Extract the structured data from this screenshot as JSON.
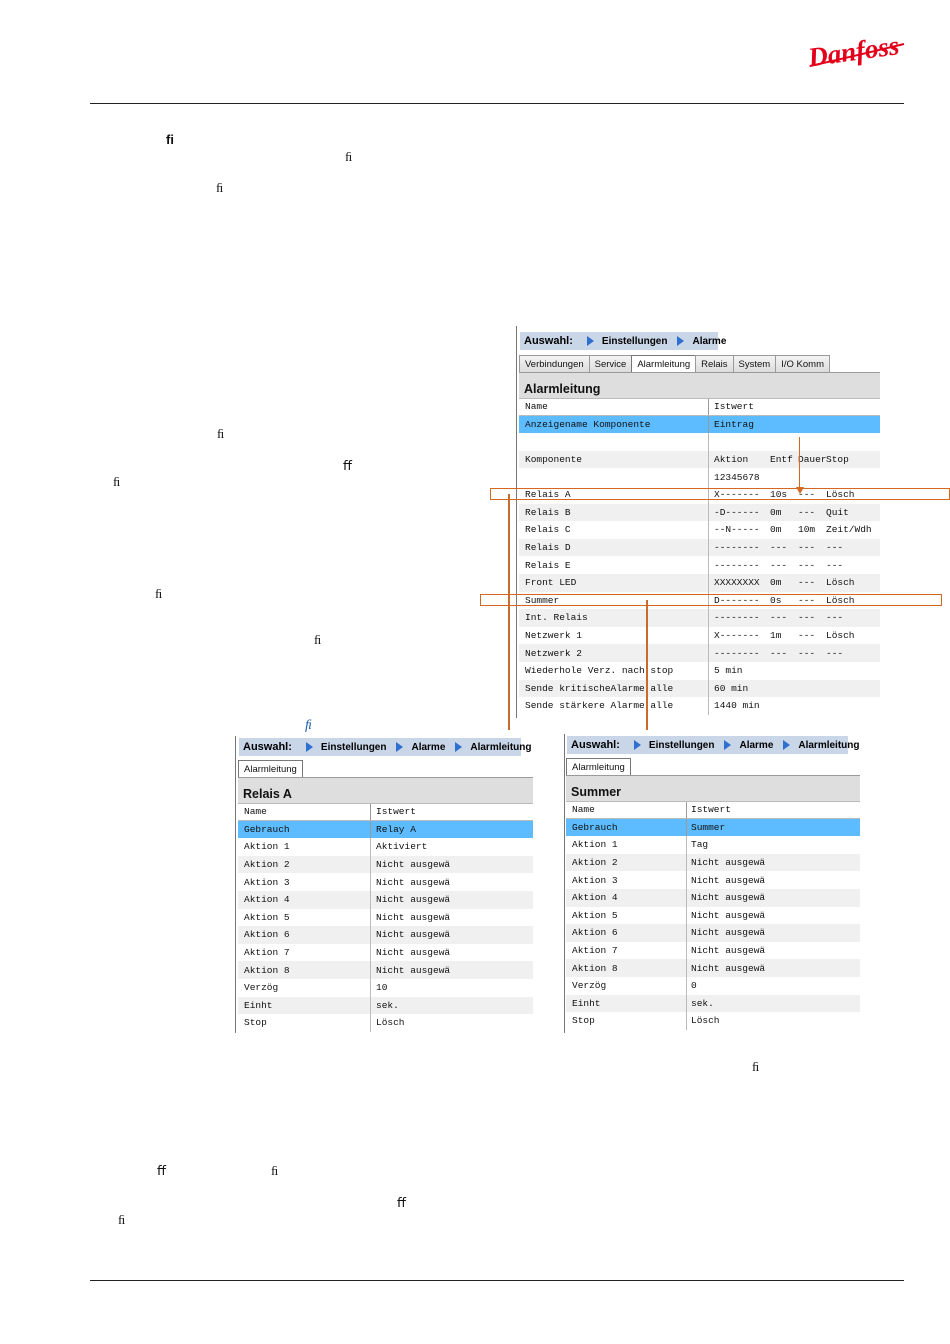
{
  "brand": {
    "logo_text": "Danfoss",
    "logo_color": "#e2001a"
  },
  "ligatures": [
    "ﬁ",
    "ﬁ",
    "ﬁ",
    "ﬁ",
    "ﬀ",
    "ﬁ",
    "ﬁ",
    "ﬁ",
    "ﬁ",
    "ﬁ",
    "ﬀ",
    "ﬁ",
    "ﬀ",
    "ﬁ"
  ],
  "alarm_panel": {
    "breadcrumb": {
      "label": "Auswahl:",
      "items": [
        "Einstellungen",
        "Alarme"
      ]
    },
    "tabs": [
      "Verbindungen",
      "Service",
      "Alarmleitung",
      "Relais",
      "System",
      "I/O Komm"
    ],
    "active_tab": 2,
    "title": "Alarmleitung",
    "header": {
      "name": "Name",
      "value": "Istwert"
    },
    "selected_row": {
      "name": "Anzeigename Komponente",
      "value": "Eintrag"
    },
    "komponente": {
      "name": "Komponente",
      "cols": [
        "Aktion",
        "Entf",
        "Dauer",
        "Stop"
      ],
      "serial": "12345678"
    },
    "rows": [
      {
        "name": "Relais A",
        "aktion": "X-------",
        "entf": "10s",
        "dauer": "---",
        "stop": "Lösch"
      },
      {
        "name": "Relais B",
        "aktion": "-D------",
        "entf": "0m",
        "dauer": "---",
        "stop": "Quit"
      },
      {
        "name": "Relais C",
        "aktion": "--N-----",
        "entf": "0m",
        "dauer": "10m",
        "stop": "Zeit/Wdh"
      },
      {
        "name": "Relais D",
        "aktion": "--------",
        "entf": "---",
        "dauer": "---",
        "stop": "---"
      },
      {
        "name": "Relais E",
        "aktion": "--------",
        "entf": "---",
        "dauer": "---",
        "stop": "---"
      },
      {
        "name": "Front LED",
        "aktion": "XXXXXXXX",
        "entf": "0m",
        "dauer": "---",
        "stop": "Lösch"
      },
      {
        "name": "Summer",
        "aktion": "D-------",
        "entf": "0s",
        "dauer": "---",
        "stop": "Lösch"
      },
      {
        "name": "Int. Relais",
        "aktion": "--------",
        "entf": "---",
        "dauer": "---",
        "stop": "---"
      },
      {
        "name": "Netzwerk 1",
        "aktion": "X-------",
        "entf": "1m",
        "dauer": "---",
        "stop": "Lösch"
      },
      {
        "name": "Netzwerk 2",
        "aktion": "--------",
        "entf": "---",
        "dauer": "---",
        "stop": "---"
      }
    ],
    "footer_rows": [
      {
        "name": "Wiederhole Verz. nach stop",
        "value": "5 min"
      },
      {
        "name": "Sende kritischeAlarme  alle",
        "value": "60 min"
      },
      {
        "name": "Sende stärkere Alarme alle",
        "value": "1440 min"
      }
    ]
  },
  "relais_panel": {
    "breadcrumb": {
      "label": "Auswahl:",
      "items": [
        "Einstellungen",
        "Alarme",
        "Alarmleitung"
      ]
    },
    "tab": "Alarmleitung",
    "title": "Relais A",
    "header": {
      "name": "Name",
      "value": "Istwert"
    },
    "rows": [
      {
        "name": "Gebrauch",
        "value": "Relay A"
      },
      {
        "name": "Aktion 1",
        "value": "Aktiviert"
      },
      {
        "name": "Aktion 2",
        "value": "Nicht ausgewä"
      },
      {
        "name": "Aktion 3",
        "value": "Nicht ausgewä"
      },
      {
        "name": "Aktion 4",
        "value": "Nicht ausgewä"
      },
      {
        "name": "Aktion 5",
        "value": "Nicht ausgewä"
      },
      {
        "name": "Aktion 6",
        "value": "Nicht ausgewä"
      },
      {
        "name": "Aktion 7",
        "value": "Nicht ausgewä"
      },
      {
        "name": "Aktion 8",
        "value": "Nicht ausgewä"
      },
      {
        "name": "Verzög",
        "value": "10"
      },
      {
        "name": "Einht",
        "value": "sek."
      },
      {
        "name": "Stop",
        "value": "Lösch"
      }
    ]
  },
  "summer_panel": {
    "breadcrumb": {
      "label": "Auswahl:",
      "items": [
        "Einstellungen",
        "Alarme",
        "Alarmleitung"
      ]
    },
    "tab": "Alarmleitung",
    "title": "Summer",
    "header": {
      "name": "Name",
      "value": "Istwert"
    },
    "rows": [
      {
        "name": "Gebrauch",
        "value": "Summer"
      },
      {
        "name": "Aktion 1",
        "value": "Tag"
      },
      {
        "name": "Aktion 2",
        "value": "Nicht ausgewä"
      },
      {
        "name": "Aktion 3",
        "value": "Nicht ausgewä"
      },
      {
        "name": "Aktion 4",
        "value": "Nicht ausgewä"
      },
      {
        "name": "Aktion 5",
        "value": "Nicht ausgewä"
      },
      {
        "name": "Aktion 6",
        "value": "Nicht ausgewä"
      },
      {
        "name": "Aktion 7",
        "value": "Nicht ausgewä"
      },
      {
        "name": "Aktion 8",
        "value": "Nicht ausgewä"
      },
      {
        "name": "Verzög",
        "value": "0"
      },
      {
        "name": "Einht",
        "value": "sek."
      },
      {
        "name": "Stop",
        "value": "Lösch"
      }
    ]
  },
  "colors": {
    "selection": "#5cbcff",
    "breadcrumb_bg": "#c9d6e8",
    "highlight": "#d2691e"
  }
}
